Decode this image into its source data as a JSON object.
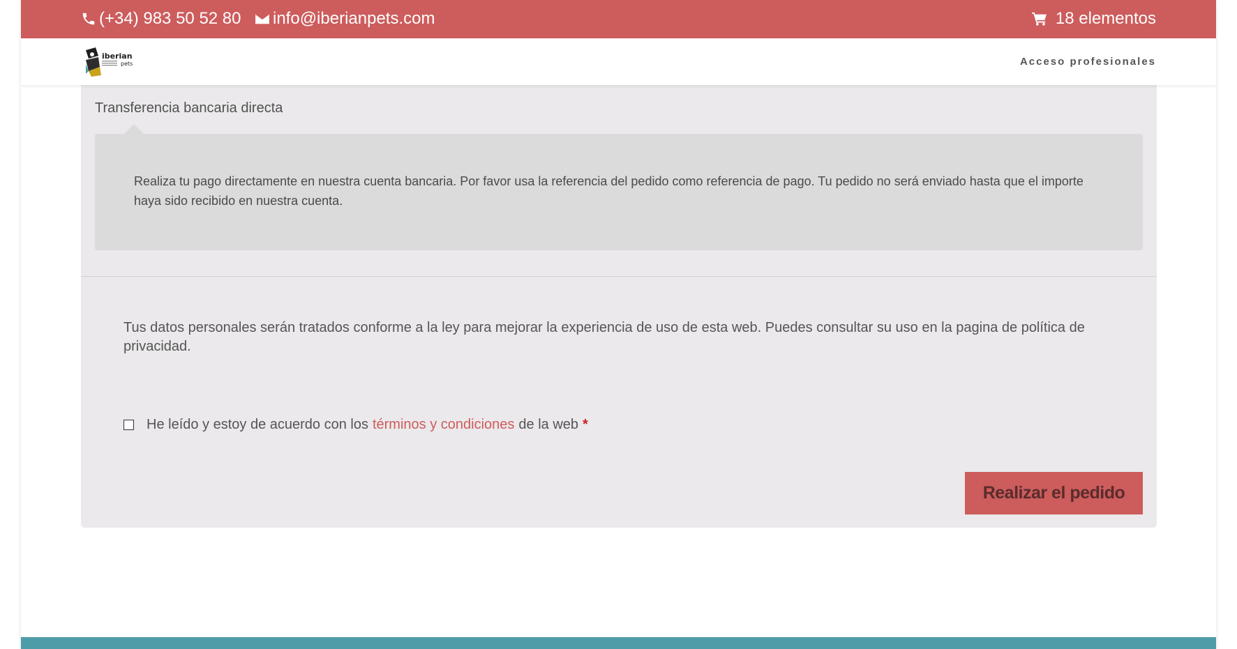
{
  "top_bar": {
    "phone": "(+34) 983 50 52 80",
    "email": "info@iberianpets.com",
    "cart": "18 elementos",
    "background_color": "#cd5c5c"
  },
  "header": {
    "logo_text": "iberian",
    "logo_subtext": "pets",
    "nav_link": "Acceso profesionales"
  },
  "checkout": {
    "payment_method_label": "Transferencia bancaria directa",
    "payment_description": "Realiza tu pago directamente en nuestra cuenta bancaria. Por favor usa la referencia del pedido como referencia de pago. Tu pedido no será enviado hasta que el importe haya sido recibido en nuestra cuenta.",
    "privacy_notice": "Tus datos personales serán tratados conforme a la ley para mejorar la experiencia de uso de esta web. Puedes consultar su uso en la pagina de política de privacidad.",
    "terms_prefix": "He leído y estoy de acuerdo con los",
    "terms_link": "términos y condiciones",
    "terms_suffix": "de la web",
    "required_marker": "*",
    "terms_checked": false,
    "place_order_label": "Realizar el pedido"
  },
  "colors": {
    "accent": "#cd5c5c",
    "panel_bg": "#ebe9eb",
    "footer": "#4d9ca8"
  }
}
